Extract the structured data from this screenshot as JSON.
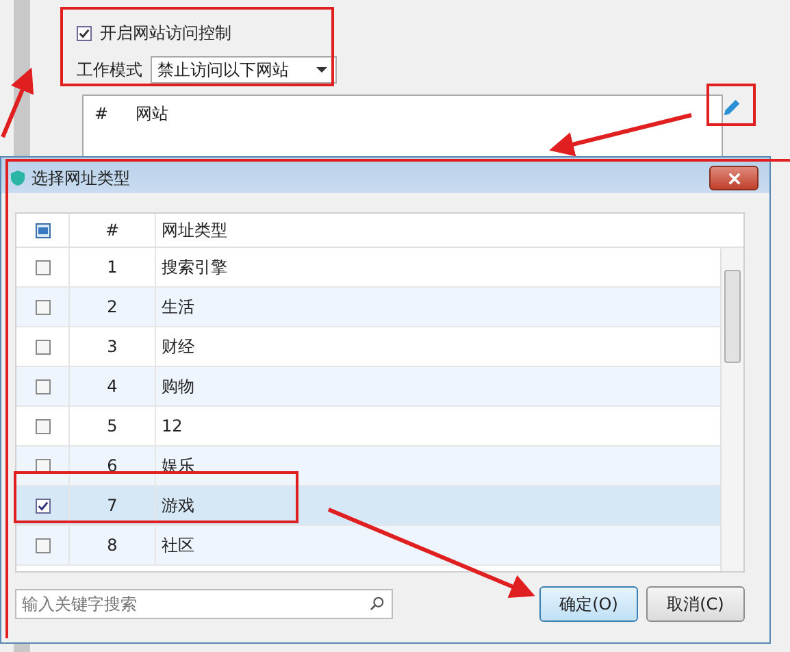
{
  "background": {
    "enable_checkbox": {
      "label": "开启网站访问控制",
      "checked": true
    },
    "work_mode": {
      "label": "工作模式",
      "value": "禁止访问以下网站"
    },
    "table": {
      "columns": [
        "#",
        "网站"
      ]
    }
  },
  "dialog": {
    "title": "选择网址类型",
    "table": {
      "header_checkbox": {
        "indeterminate": true
      },
      "columns": [
        "#",
        "网址类型"
      ],
      "rows": [
        {
          "number": "1",
          "type": "搜索引擎",
          "checked": false,
          "selected": false
        },
        {
          "number": "2",
          "type": "生活",
          "checked": false,
          "selected": false
        },
        {
          "number": "3",
          "type": "财经",
          "checked": false,
          "selected": false
        },
        {
          "number": "4",
          "type": "购物",
          "checked": false,
          "selected": false
        },
        {
          "number": "5",
          "type": "12",
          "checked": false,
          "selected": false
        },
        {
          "number": "6",
          "type": "娱乐",
          "checked": false,
          "selected": false
        },
        {
          "number": "7",
          "type": "游戏",
          "checked": true,
          "selected": true
        },
        {
          "number": "8",
          "type": "社区",
          "checked": false,
          "selected": false
        }
      ]
    },
    "search": {
      "placeholder": "输入关键字搜索"
    },
    "buttons": [
      {
        "label": "确定(O)",
        "default": true
      },
      {
        "label": "取消(C)",
        "default": false
      }
    ]
  }
}
